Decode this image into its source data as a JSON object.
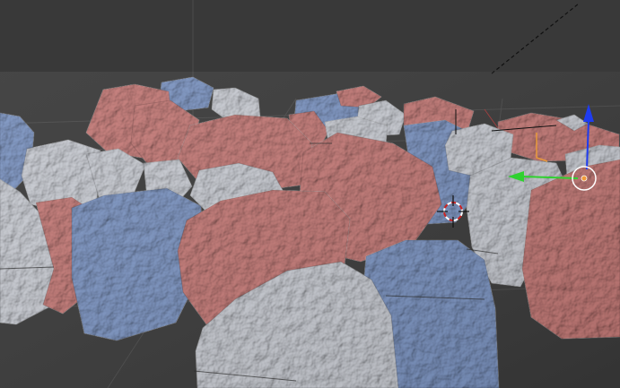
{
  "viewport": {
    "background": "#393939",
    "grid_color": "#4a4a4a",
    "axis_x_color": "#9a3a3a",
    "axis_y_color": "#7a9a3a"
  },
  "rocks": {
    "colors": {
      "pink": "#c57b78",
      "blue": "#7d95c2",
      "white": "#c9ccd3"
    }
  },
  "gizmo": {
    "x_axis_color": "#2fd12f",
    "z_axis_color": "#1f3cf0",
    "origin_ring_color": "#ffffff"
  },
  "cursor": {
    "ring_colors": [
      "#ffffff",
      "#cc2222"
    ]
  },
  "selection": {
    "outline_color": "#e89a3a"
  },
  "icons": [
    "3d-cursor-icon",
    "move-arrow-x-icon",
    "move-arrow-z-icon",
    "object-origin-icon"
  ]
}
